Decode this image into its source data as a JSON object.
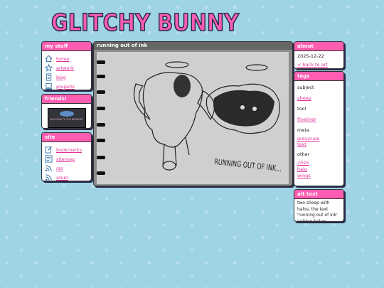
{
  "site": {
    "title": "GLITCHY BUNNY"
  },
  "my_stuff": {
    "header": "my stuff",
    "items": [
      {
        "label": "home",
        "icon": "house-icon"
      },
      {
        "label": "artwork",
        "icon": "star-icon"
      },
      {
        "label": "blog",
        "icon": "notebook-icon"
      },
      {
        "label": "projects",
        "icon": "computer-icon"
      }
    ]
  },
  "friends": {
    "header": "friends!",
    "button_text": "WELCOME TO THE INTERNET"
  },
  "site_links": {
    "header": "site",
    "items": [
      {
        "label": "bookmarks",
        "icon": "edit-icon"
      },
      {
        "label": "sitemap",
        "icon": "sitemap-icon"
      },
      {
        "label": "rss",
        "icon": "rss-icon"
      },
      {
        "label": "atom",
        "icon": "rss-icon"
      }
    ]
  },
  "main": {
    "title": "running out of ink",
    "caption": "RUNNING OUT OF INK..."
  },
  "about": {
    "header": "about",
    "date": "2025-12-22",
    "back_link": "< back to art"
  },
  "tags": {
    "header": "tags",
    "subject_label": "subject",
    "subject": [
      "sheep"
    ],
    "tool_label": "tool",
    "tool": [
      "fineliner"
    ],
    "meta_label": "meta",
    "meta": [
      "greyscale",
      "text"
    ],
    "other_label": "other",
    "other": [
      "2025",
      "halo",
      "wings"
    ]
  },
  "alt_text": {
    "header": "alt text",
    "text": "two sheep with halos, the text 'running out of ink' written below."
  }
}
